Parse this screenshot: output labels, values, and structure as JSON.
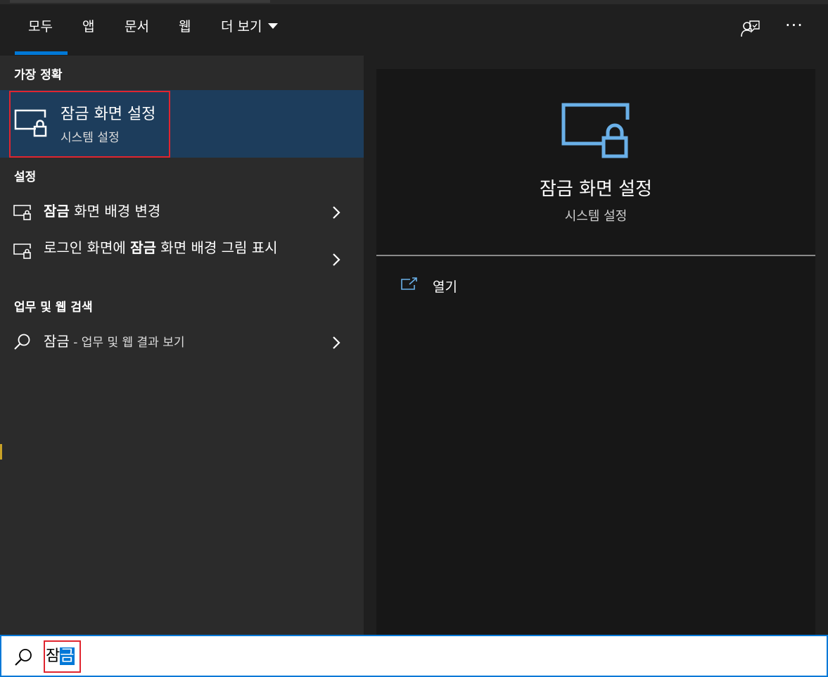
{
  "tabs": [
    {
      "label": "모두"
    },
    {
      "label": "앱"
    },
    {
      "label": "문서"
    },
    {
      "label": "웹"
    },
    {
      "label": "더 보기"
    }
  ],
  "toolbar": {
    "more_options": "···"
  },
  "best_match": {
    "header": "가장 정확",
    "title": "잠금 화면 설정",
    "subtitle": "시스템 설정"
  },
  "settings": {
    "header": "설정",
    "items": [
      {
        "bold": "잠금",
        "rest": " 화면 배경 변경"
      },
      {
        "pre": "로그인 화면에 ",
        "bold": "잠금",
        "rest": " 화면 배경 그림 표시"
      }
    ]
  },
  "web": {
    "header": "업무 및 웹 검색",
    "query": "잠금",
    "suffix": " - 업무 및 웹 결과 보기"
  },
  "preview": {
    "title": "잠금 화면 설정",
    "subtitle": "시스템 설정",
    "open_label": "열기"
  },
  "search": {
    "typed": "잠",
    "selected": "금"
  },
  "colors": {
    "accent": "#0078d7",
    "highlight_border": "#e0252f",
    "selected_row": "#1d3d5c",
    "icon_blue": "#6ab0e8"
  }
}
